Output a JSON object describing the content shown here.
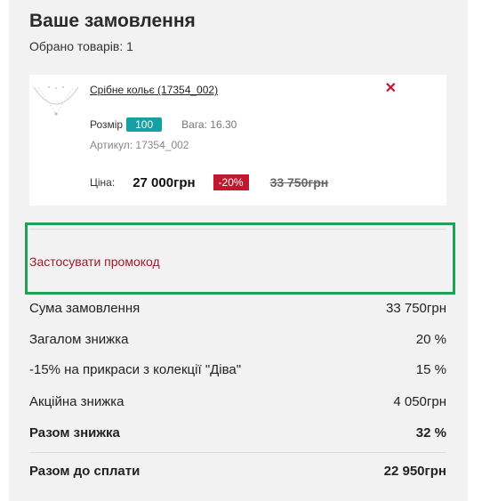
{
  "order": {
    "title": "Ваше замовлення",
    "selected_count": "Обрано товарів: 1"
  },
  "product": {
    "name": "Срібне кольє (17354_002)",
    "size_label": "Розмір",
    "size_value": "100",
    "weight": "Вага: 16.30",
    "article": "Артикул: 17354_002",
    "price_label": "Ціна:",
    "price_current": "27 000грн",
    "discount": "-20%",
    "price_old": "33 750грн",
    "remove_icon": "✕"
  },
  "promo": {
    "link_text": "Застосувати промокод"
  },
  "summary": {
    "rows": [
      {
        "label": "Сума замовлення",
        "value": "33 750грн"
      },
      {
        "label": "Загалом знижка",
        "value": "20 %"
      },
      {
        "label": "-15% на прикраси з колекції \"Діва\"",
        "value": "15 %"
      },
      {
        "label": "Акційна знижка",
        "value": "4 050грн"
      },
      {
        "label": "Разом знижка",
        "value": "32 %"
      },
      {
        "label": "Разом до сплати",
        "value": "22 950грн"
      }
    ]
  },
  "colors": {
    "accent": "#c0182f",
    "size_badge": "#16a0a4",
    "highlight": "#22a055",
    "panel": "#f2f2f2"
  }
}
